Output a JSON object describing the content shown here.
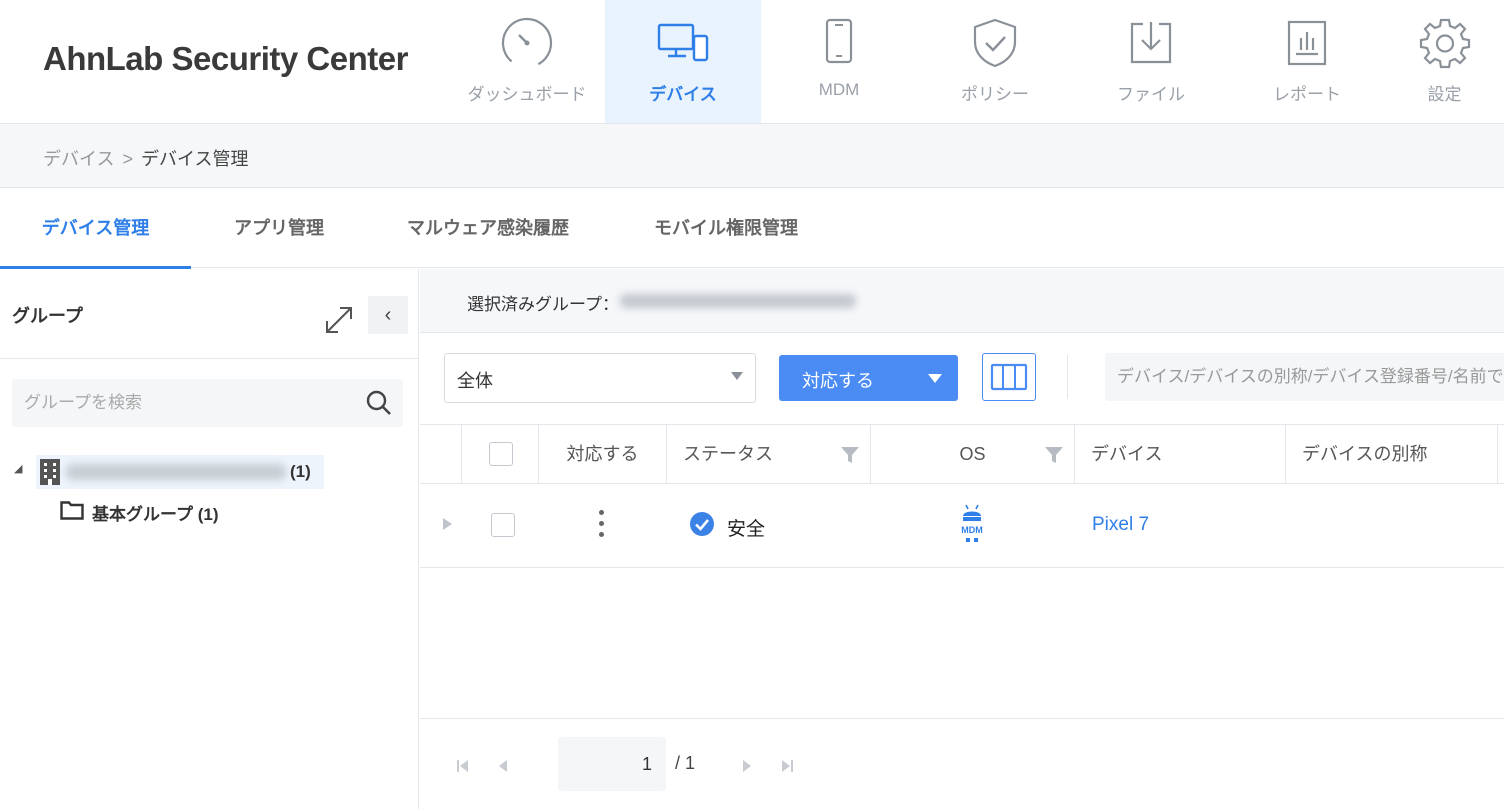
{
  "app": {
    "title": "AhnLab Security Center"
  },
  "nav": [
    {
      "label": "ダッシュボード",
      "icon": "gauge-icon"
    },
    {
      "label": "デバイス",
      "icon": "devices-icon",
      "active": true
    },
    {
      "label": "MDM",
      "icon": "smartphone-icon"
    },
    {
      "label": "ポリシー",
      "icon": "shield-check-icon"
    },
    {
      "label": "ファイル",
      "icon": "download-box-icon"
    },
    {
      "label": "レポート",
      "icon": "report-chart-icon"
    },
    {
      "label": "設定",
      "icon": "gear-icon"
    }
  ],
  "breadcrumb": {
    "parent": "デバイス",
    "separator": ">",
    "current": "デバイス管理"
  },
  "tabs": [
    {
      "label": "デバイス管理",
      "active": true
    },
    {
      "label": "アプリ管理"
    },
    {
      "label": "マルウェア感染履歴"
    },
    {
      "label": "モバイル権限管理"
    }
  ],
  "groups": {
    "title": "グループ",
    "collapse_glyph": "‹",
    "search_placeholder": "グループを検索",
    "tree": {
      "root_count": "(1)",
      "children": [
        {
          "label": "基本グループ (1)"
        }
      ]
    }
  },
  "main": {
    "selected_group_label": "選択済みグループ：",
    "filter": {
      "value": "全体"
    },
    "action_button": "対応する",
    "search_placeholder": "デバイス/デバイスの別称/デバイス登録番号/名前で検索",
    "table": {
      "headers": {
        "action": "対応する",
        "status": "ステータス",
        "os": "OS",
        "device": "デバイス",
        "alias": "デバイスの別称"
      },
      "rows": [
        {
          "status": "安全",
          "os": "MDM",
          "device": "Pixel 7",
          "alias": ""
        }
      ]
    },
    "pagination": {
      "current": "1",
      "total": "/ 1"
    }
  },
  "colors": {
    "accent": "#2f7fe8",
    "button": "#4a8cf4",
    "nav_active_bg": "#e8f3fe",
    "icon_gray": "#8a9098"
  }
}
